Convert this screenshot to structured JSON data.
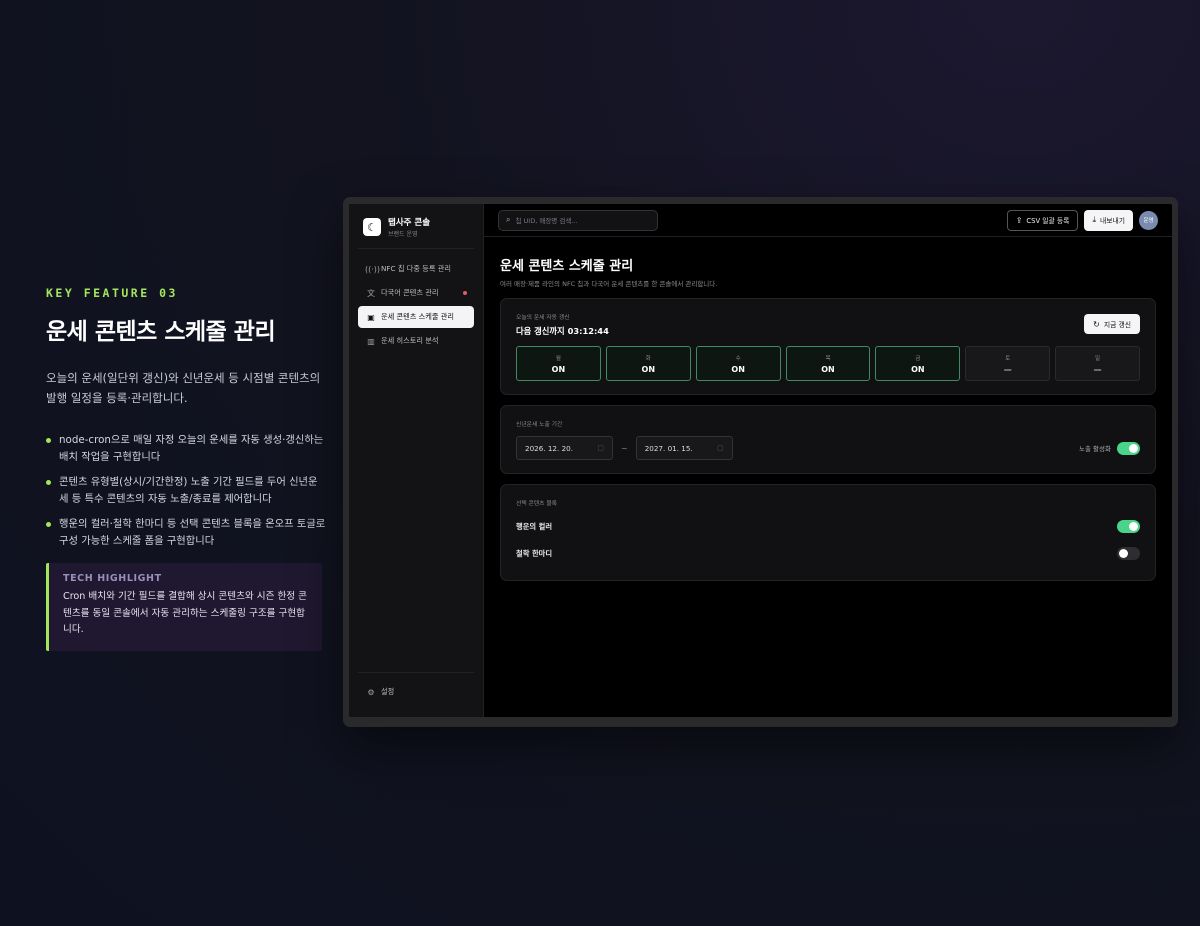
{
  "feature": {
    "eyebrow": "KEY FEATURE 03",
    "title": "운세 콘텐츠 스케줄 관리",
    "description": "오늘의 운세(일단위 갱신)와 신년운세 등 시점별 콘텐츠의 발행 일정을 등록·관리합니다.",
    "bullets": [
      "node-cron으로 매일 자정 오늘의 운세를 자동 생성·갱신하는 배치 작업을 구현합니다",
      "콘텐츠 유형별(상시/기간한정) 노출 기간 필드를 두어 신년운세 등 특수 콘텐츠의 자동 노출/종료를 제어합니다",
      "행운의 컬러·철학 한마디 등 선택 콘텐츠 블록을 온오프 토글로 구성 가능한 스케줄 폼을 구현합니다"
    ],
    "highlight": {
      "label": "TECH HIGHLIGHT",
      "text": "Cron 배치와 기간 필드를 결합해 상시 콘텐츠와 시즌 한정 콘텐츠를 동일 콘솔에서 자동 관리하는 스케줄링 구조를 구현합니다."
    }
  },
  "app": {
    "brand": {
      "name": "탭사주 콘솔",
      "sub": "브랜드 운영"
    },
    "nav": [
      {
        "label": "NFC 칩 다중 등록 관리",
        "icon": "nfc-icon"
      },
      {
        "label": "다국어 콘텐츠 관리",
        "icon": "translate-icon",
        "dot": true
      },
      {
        "label": "운세 콘텐츠 스케줄 관리",
        "icon": "calendar-icon",
        "active": true
      },
      {
        "label": "운세 히스토리 분석",
        "icon": "chart-icon"
      }
    ],
    "settings_label": "설정",
    "search_placeholder": "칩 UID, 매장명 검색...",
    "csv_button": "CSV 일괄 등록",
    "export_button": "내보내기",
    "avatar_text": "운영",
    "page_title": "운세 콘텐츠 스케줄 관리",
    "page_subtitle": "여러 매장·제품 라인의 NFC 칩과 다국어 운세 콘텐츠를 한 콘솔에서 관리합니다.",
    "daily": {
      "label": "오늘의 운세 자동 갱신",
      "countdown": "다음 갱신까지 03:12:44",
      "refresh_button": "지금 갱신",
      "days": [
        {
          "name": "월",
          "state": "ON",
          "on": true
        },
        {
          "name": "화",
          "state": "ON",
          "on": true
        },
        {
          "name": "수",
          "state": "ON",
          "on": true
        },
        {
          "name": "목",
          "state": "ON",
          "on": true
        },
        {
          "name": "금",
          "state": "ON",
          "on": true
        },
        {
          "name": "토",
          "state": "—",
          "on": false
        },
        {
          "name": "일",
          "state": "—",
          "on": false
        }
      ]
    },
    "period": {
      "label": "신년운세 노출 기간",
      "start": "2026. 12. 20.",
      "end": "2027. 01. 15.",
      "separator": "~",
      "toggle_label": "노출 활성화",
      "toggle_on": true
    },
    "blocks": {
      "label": "선택 콘텐츠 블록",
      "items": [
        {
          "label": "행운의 컬러",
          "on": true
        },
        {
          "label": "철학 한마디",
          "on": false
        }
      ]
    }
  },
  "colors": {
    "accent": "#a3e65c",
    "toggle_on": "#4ad48a",
    "day_on_border": "#3f8a63",
    "nav_dot": "#e35b5b"
  }
}
